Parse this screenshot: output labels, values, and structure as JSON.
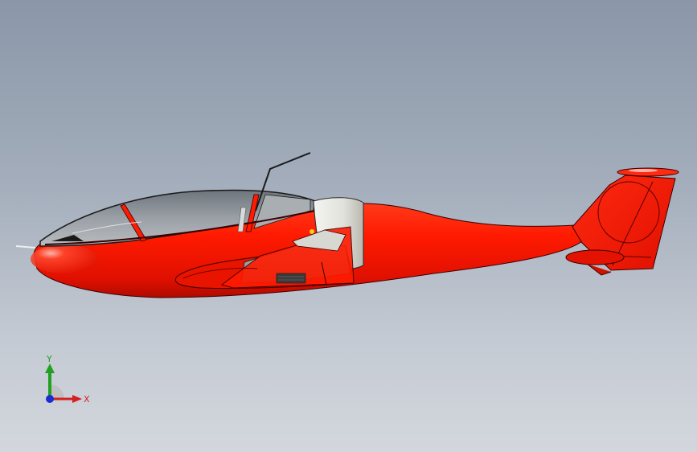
{
  "triad": {
    "x_label": "X",
    "y_label": "Y",
    "x_color": "#d42020",
    "y_color": "#22a022",
    "z_color": "#1a2ed0"
  },
  "model": {
    "body_color": "#ff1a00",
    "canopy_color": "#9aa0a6",
    "cowl_color": "#e6e6e2"
  }
}
